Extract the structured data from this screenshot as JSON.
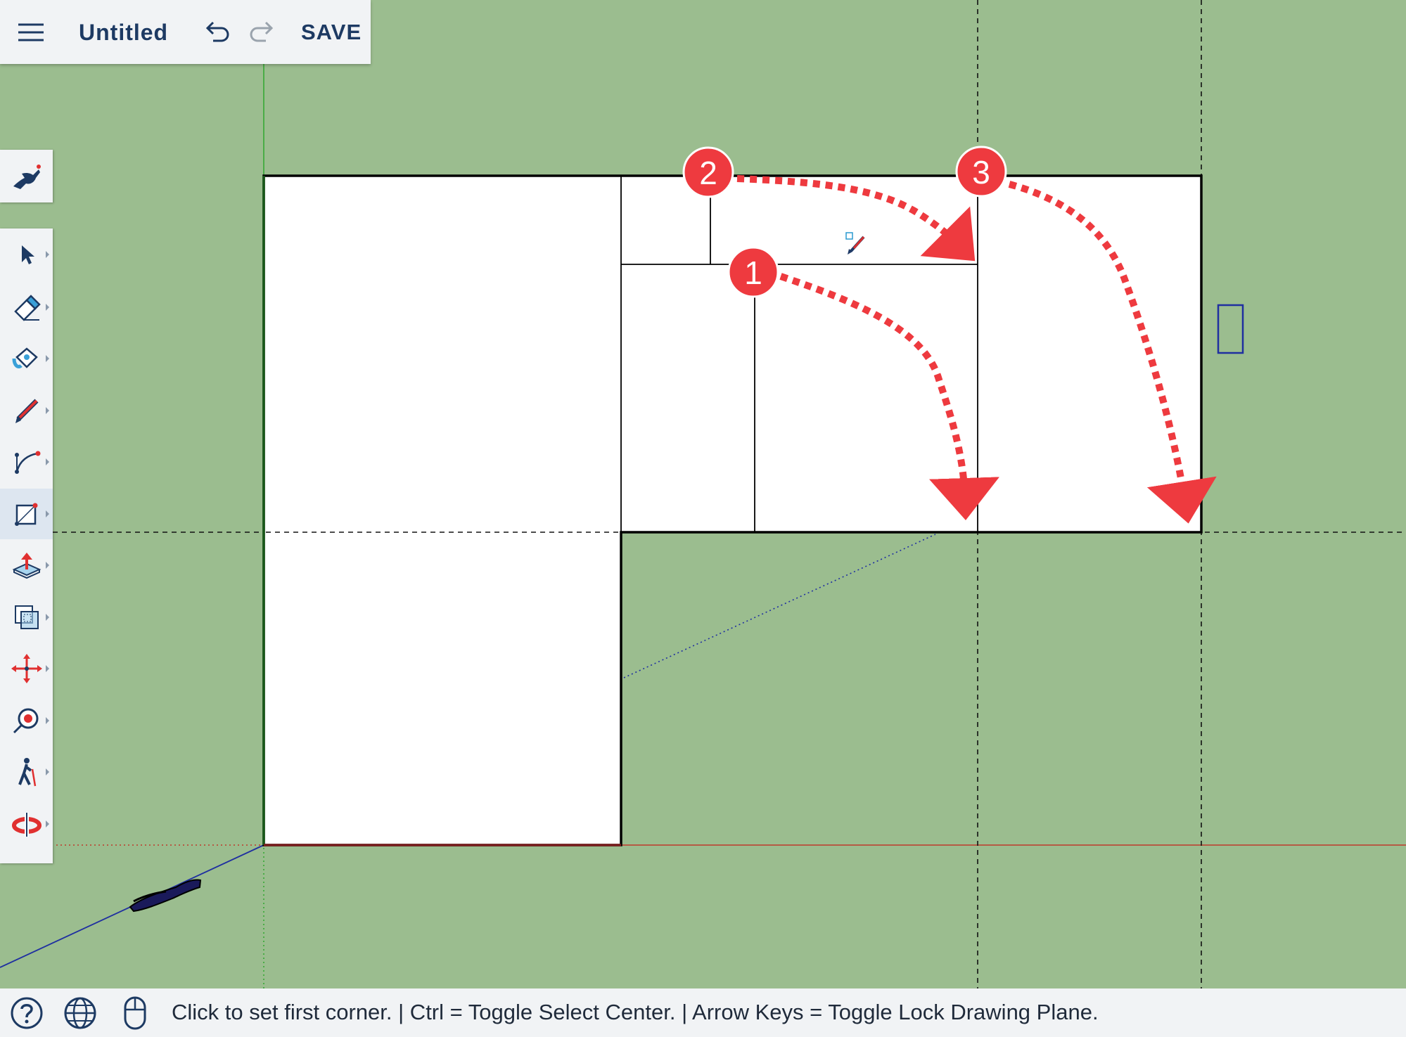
{
  "header": {
    "menu_icon": "hamburger-menu-icon",
    "title": "Untitled",
    "undo_icon": "undo-icon",
    "redo_icon": "redo-icon",
    "save_label": "SAVE"
  },
  "instructor": {
    "icon": "instructor-icon"
  },
  "tools": [
    {
      "name": "select-tool",
      "icon": "arrow-cursor-icon"
    },
    {
      "name": "eraser-tool",
      "icon": "eraser-icon"
    },
    {
      "name": "paint-bucket-tool",
      "icon": "paint-bucket-icon"
    },
    {
      "name": "line-tool",
      "icon": "pencil-icon"
    },
    {
      "name": "arc-tool",
      "icon": "arc-icon"
    },
    {
      "name": "rectangle-tool",
      "icon": "rectangle-icon",
      "active": true
    },
    {
      "name": "push-pull-tool",
      "icon": "push-pull-icon"
    },
    {
      "name": "offset-tool",
      "icon": "offset-icon"
    },
    {
      "name": "move-tool",
      "icon": "move-arrows-icon"
    },
    {
      "name": "tape-measure-tool",
      "icon": "tape-measure-icon"
    },
    {
      "name": "walk-tool",
      "icon": "walk-icon"
    },
    {
      "name": "section-plane-tool",
      "icon": "section-plane-icon"
    }
  ],
  "annotations": [
    {
      "number": "1"
    },
    {
      "number": "2"
    },
    {
      "number": "3"
    }
  ],
  "colors": {
    "ground": "#9bbd8f",
    "annotation_red": "#ee3a3f",
    "axis_red": "#c0392b",
    "axis_green": "#2fa82f",
    "axis_blue": "#1f2fa0",
    "ui_navy": "#1d3a63"
  },
  "status": {
    "help_icon": "help-icon",
    "globe_icon": "globe-icon",
    "mouse_icon": "mouse-icon",
    "text": "Click to set first corner. | Ctrl = Toggle Select Center. | Arrow Keys = Toggle Lock Drawing Plane."
  }
}
